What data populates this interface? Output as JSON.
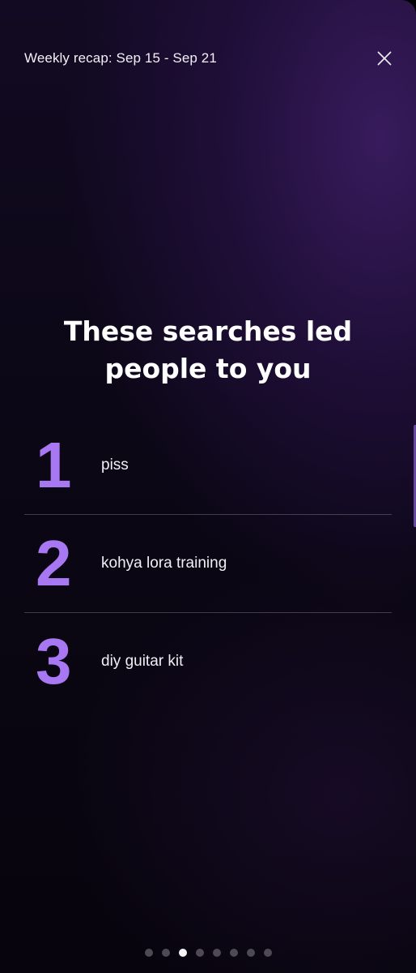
{
  "header": {
    "title": "Weekly recap: Sep 15 - Sep 21",
    "close_icon": "close-icon"
  },
  "headline": "These searches led people to you",
  "results": [
    {
      "rank": "1",
      "term": "piss"
    },
    {
      "rank": "2",
      "term": "kohya lora training"
    },
    {
      "rank": "3",
      "term": "diy guitar kit"
    }
  ],
  "pagination": {
    "total": 8,
    "active_index": 2
  },
  "colors": {
    "rank_accent": "#a778f2",
    "background": "#0b0715",
    "active_dot": "#f4f4f6",
    "inactive_dot": "#4d4a54"
  }
}
